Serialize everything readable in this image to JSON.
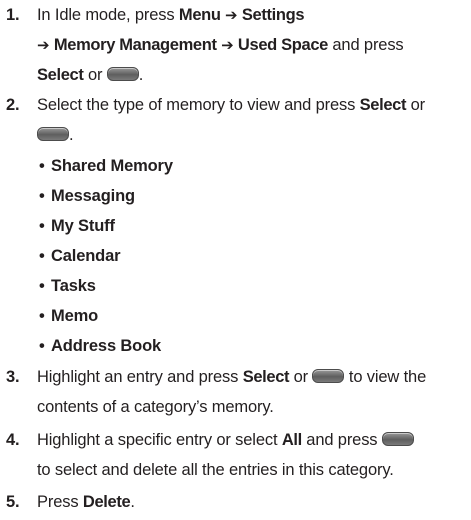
{
  "steps": [
    {
      "number": "1.",
      "parts": {
        "a": "In Idle mode, press ",
        "b_menu": "Menu",
        "arrow1": "➔",
        "b_settings": "Settings",
        "arrow2": "➔",
        "b_memory": "Memory Management",
        "arrow3": "➔",
        "b_used": "Used Space",
        "c": " and press",
        "b_select": "Select",
        "d": " or ",
        "e": "."
      }
    },
    {
      "number": "2.",
      "parts": {
        "a": "Select the type of memory to view and press ",
        "b_select": "Select",
        "c": " or",
        "d": "."
      }
    },
    {
      "number": "3.",
      "parts": {
        "a": "Highlight an entry and press ",
        "b_select": "Select",
        "b": " or ",
        "c": " to view the",
        "d": "contents of a category’s memory."
      }
    },
    {
      "number": "4.",
      "parts": {
        "a": "Highlight a specific entry or select ",
        "b_all": "All",
        "b": " and press ",
        "c": "to select and delete all the entries in this category."
      }
    },
    {
      "number": "5.",
      "parts": {
        "a": "Press ",
        "b_delete": "Delete",
        "c": "."
      }
    }
  ],
  "memory_types": [
    "Shared Memory",
    "Messaging",
    "My Stuff",
    "Calendar",
    "Tasks",
    "Memo",
    "Address Book"
  ],
  "icons": {
    "select_key": "select-key-icon"
  }
}
